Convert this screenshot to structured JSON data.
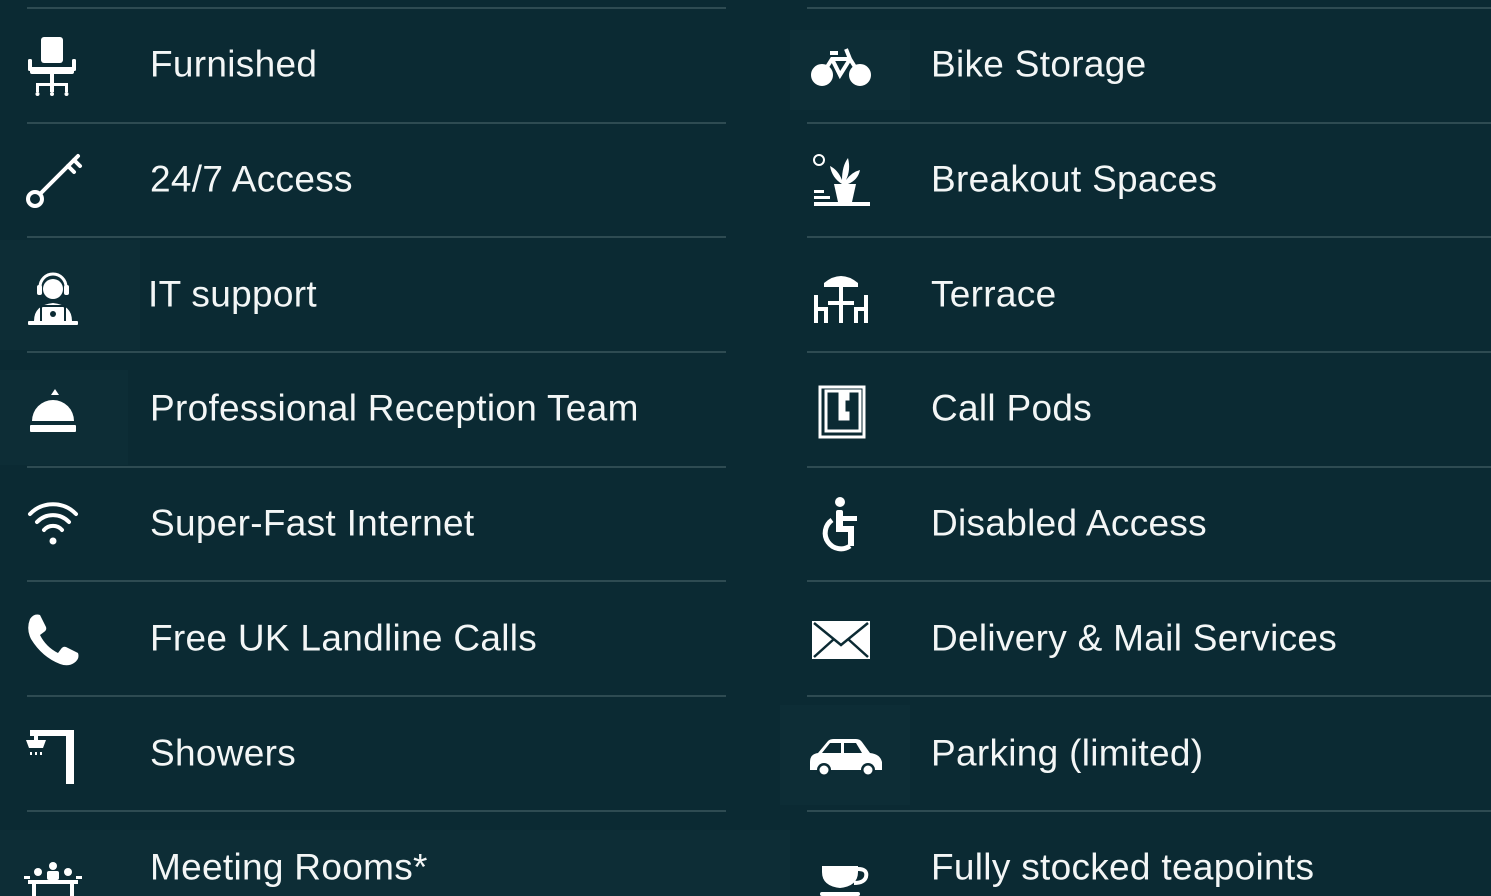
{
  "colors": {
    "background": "#0b2a33",
    "divider": "#2e4b52",
    "text": "#f3f6f6",
    "icon": "#ffffff"
  },
  "left_column": {
    "items": [
      {
        "label": "Furnished",
        "icon": "office-chair-icon"
      },
      {
        "label": "24/7 Access",
        "icon": "key-icon"
      },
      {
        "label": "IT support",
        "icon": "support-agent-icon"
      },
      {
        "label": "Professional Reception Team",
        "icon": "reception-bell-icon"
      },
      {
        "label": "Super-Fast Internet",
        "icon": "wifi-icon"
      },
      {
        "label": "Free UK Landline Calls",
        "icon": "phone-icon"
      },
      {
        "label": "Showers",
        "icon": "shower-icon"
      },
      {
        "label": "Meeting Rooms*",
        "icon": "meeting-room-icon"
      }
    ]
  },
  "right_column": {
    "items": [
      {
        "label": "Bike Storage",
        "icon": "bicycle-icon"
      },
      {
        "label": "Breakout Spaces",
        "icon": "plant-lounge-icon"
      },
      {
        "label": "Terrace",
        "icon": "terrace-table-icon"
      },
      {
        "label": "Call Pods",
        "icon": "call-pod-icon"
      },
      {
        "label": "Disabled Access",
        "icon": "wheelchair-icon"
      },
      {
        "label": "Delivery & Mail Services",
        "icon": "envelope-icon"
      },
      {
        "label": "Parking (limited)",
        "icon": "car-icon"
      },
      {
        "label": "Fully stocked teapoints",
        "icon": "teacup-icon"
      }
    ]
  }
}
